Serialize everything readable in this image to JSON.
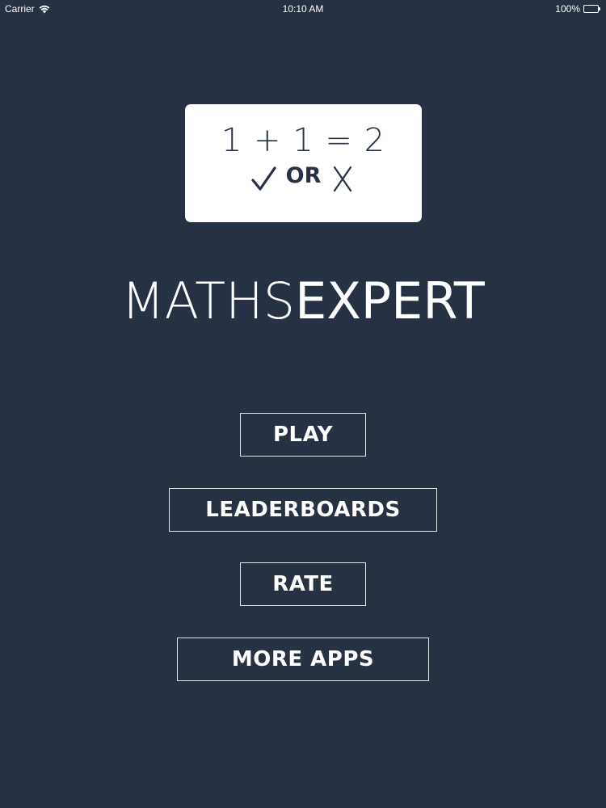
{
  "status_bar": {
    "carrier": "Carrier",
    "time": "10:10 AM",
    "battery_percent": "100%",
    "battery_level": 1.0
  },
  "logo": {
    "equation": "1 + 1 = 2",
    "or_label": "OR"
  },
  "title": {
    "light_part": "MATHS",
    "bold_part": "EXPERT"
  },
  "menu": {
    "play_label": "PLAY",
    "leaderboards_label": "LEADERBOARDS",
    "rate_label": "RATE",
    "more_apps_label": "MORE APPS"
  },
  "colors": {
    "background": "#263143",
    "card": "#ffffff",
    "text": "#ffffff",
    "border": "#e6e8ec"
  }
}
